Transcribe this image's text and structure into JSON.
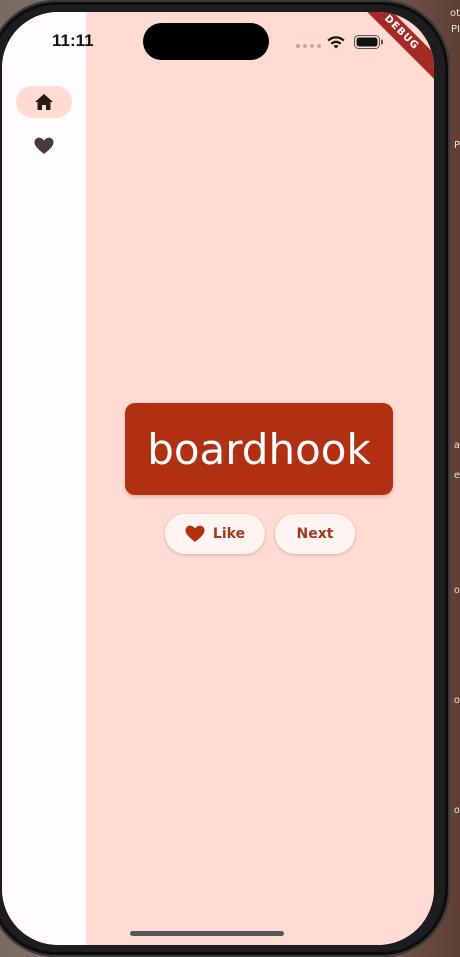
{
  "status_bar": {
    "time": "11:11",
    "debug_label": "DEBUG"
  },
  "nav_rail": {
    "items": [
      {
        "name": "home",
        "icon": "home-icon",
        "selected": true
      },
      {
        "name": "favorites",
        "icon": "heart-icon",
        "selected": false
      }
    ]
  },
  "main": {
    "word": "boardhook",
    "like_label": "Like",
    "next_label": "Next"
  },
  "colors": {
    "accent": "#b12f12",
    "background": "#ffdbd3",
    "rail": "#fffbff"
  },
  "background_fragments": [
    "ot",
    "PI",
    "P",
    "a",
    "e",
    "o",
    "o",
    "o"
  ]
}
